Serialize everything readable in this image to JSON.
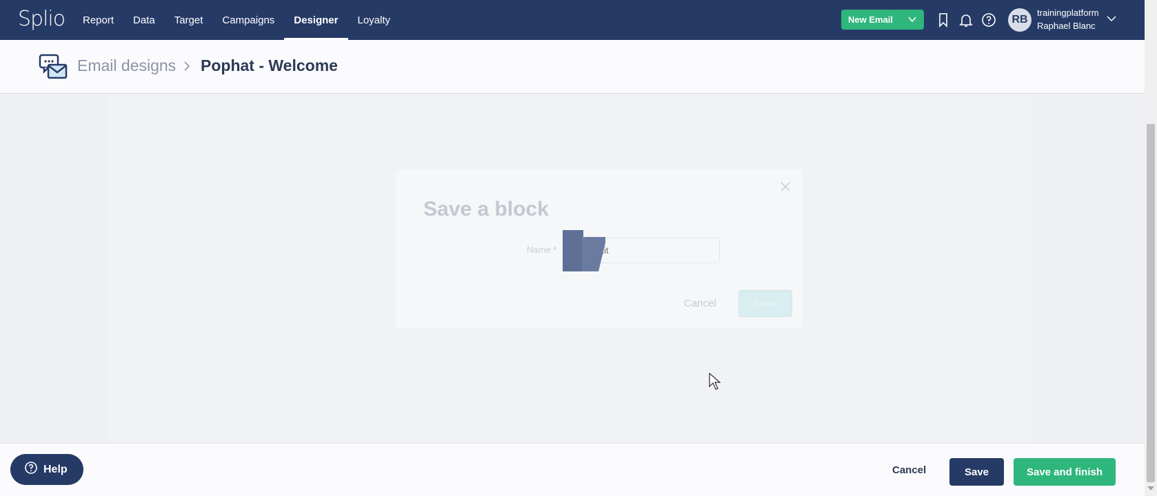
{
  "app": {
    "logo": "Splio"
  },
  "nav": {
    "items": [
      {
        "label": "Report"
      },
      {
        "label": "Data"
      },
      {
        "label": "Target"
      },
      {
        "label": "Campaigns"
      },
      {
        "label": "Designer"
      },
      {
        "label": "Loyalty"
      }
    ],
    "active": "Designer",
    "new_email_label": "New Email"
  },
  "user": {
    "initials": "RB",
    "platform": "trainingplatform",
    "name": "Raphael Blanc"
  },
  "breadcrumb": {
    "root": "Email designs",
    "current": "Pophat - Welcome"
  },
  "modal": {
    "title": "Save a block",
    "name_label": "Name *",
    "name_placeholder": "Block tit",
    "cancel_label": "Cancel",
    "save_label": "Save"
  },
  "footer": {
    "help_label": "Help",
    "cancel_label": "Cancel",
    "save_label": "Save",
    "save_finish_label": "Save and finish"
  },
  "colors": {
    "nav_bg": "#263a66",
    "accent_green": "#2eb67d",
    "primary_dark": "#263a66"
  }
}
